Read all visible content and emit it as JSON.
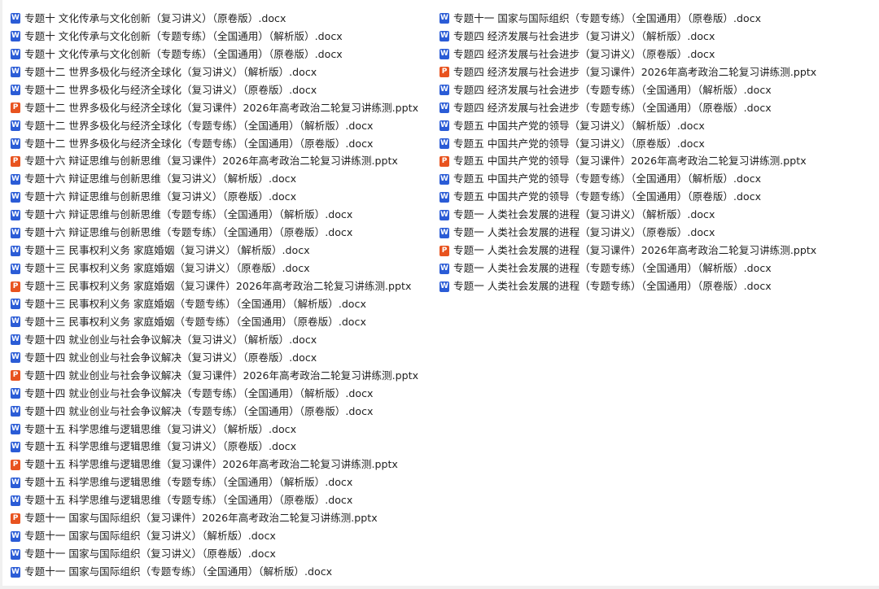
{
  "icons": {
    "docx": "word-doc-icon",
    "pptx": "powerpoint-icon",
    "docx_glyph": "W",
    "pptx_glyph": "P",
    "docx_color": "#2b5cd6",
    "pptx_color": "#e8531f"
  },
  "left_files": [
    {
      "type": "docx",
      "name": "专题十 文化传承与文化创新（复习讲义）（原卷版）.docx"
    },
    {
      "type": "docx",
      "name": "专题十 文化传承与文化创新（专题专练）（全国通用）（解析版）.docx"
    },
    {
      "type": "docx",
      "name": "专题十 文化传承与文化创新（专题专练）（全国通用）（原卷版）.docx"
    },
    {
      "type": "docx",
      "name": "专题十二 世界多极化与经济全球化（复习讲义）（解析版）.docx"
    },
    {
      "type": "docx",
      "name": "专题十二 世界多极化与经济全球化（复习讲义）（原卷版）.docx"
    },
    {
      "type": "pptx",
      "name": "专题十二 世界多极化与经济全球化（复习课件）2026年高考政治二轮复习讲练测.pptx"
    },
    {
      "type": "docx",
      "name": "专题十二 世界多极化与经济全球化（专题专练）（全国通用）（解析版）.docx"
    },
    {
      "type": "docx",
      "name": "专题十二 世界多极化与经济全球化（专题专练）（全国通用）（原卷版）.docx"
    },
    {
      "type": "pptx",
      "name": "专题十六 辩证思维与创新思维（复习课件）2026年高考政治二轮复习讲练测.pptx"
    },
    {
      "type": "docx",
      "name": "专题十六 辩证思维与创新思维（复习讲义）（解析版）.docx"
    },
    {
      "type": "docx",
      "name": "专题十六 辩证思维与创新思维（复习讲义）（原卷版）.docx"
    },
    {
      "type": "docx",
      "name": "专题十六 辩证思维与创新思维（专题专练）（全国通用）（解析版）.docx"
    },
    {
      "type": "docx",
      "name": "专题十六 辩证思维与创新思维（专题专练）（全国通用）（原卷版）.docx"
    },
    {
      "type": "docx",
      "name": "专题十三 民事权利义务 家庭婚姻（复习讲义）（解析版）.docx"
    },
    {
      "type": "docx",
      "name": "专题十三 民事权利义务 家庭婚姻（复习讲义）（原卷版）.docx"
    },
    {
      "type": "pptx",
      "name": "专题十三 民事权利义务 家庭婚姻（复习课件）2026年高考政治二轮复习讲练测.pptx"
    },
    {
      "type": "docx",
      "name": "专题十三 民事权利义务 家庭婚姻（专题专练）（全国通用）（解析版）.docx"
    },
    {
      "type": "docx",
      "name": "专题十三 民事权利义务 家庭婚姻（专题专练）（全国通用）（原卷版）.docx"
    },
    {
      "type": "docx",
      "name": "专题十四 就业创业与社会争议解决（复习讲义）（解析版）.docx"
    },
    {
      "type": "docx",
      "name": "专题十四 就业创业与社会争议解决（复习讲义）（原卷版）.docx"
    },
    {
      "type": "pptx",
      "name": "专题十四 就业创业与社会争议解决（复习课件）2026年高考政治二轮复习讲练测.pptx"
    },
    {
      "type": "docx",
      "name": "专题十四 就业创业与社会争议解决（专题专练）（全国通用）（解析版）.docx"
    },
    {
      "type": "docx",
      "name": "专题十四 就业创业与社会争议解决（专题专练）（全国通用）（原卷版）.docx"
    },
    {
      "type": "docx",
      "name": "专题十五 科学思维与逻辑思维（复习讲义）（解析版）.docx"
    },
    {
      "type": "docx",
      "name": "专题十五 科学思维与逻辑思维（复习讲义）（原卷版）.docx"
    },
    {
      "type": "pptx",
      "name": "专题十五 科学思维与逻辑思维（复习课件）2026年高考政治二轮复习讲练测.pptx"
    },
    {
      "type": "docx",
      "name": "专题十五 科学思维与逻辑思维（专题专练）（全国通用）（解析版）.docx"
    },
    {
      "type": "docx",
      "name": "专题十五 科学思维与逻辑思维（专题专练）（全国通用）（原卷版）.docx"
    },
    {
      "type": "pptx",
      "name": "专题十一 国家与国际组织（复习课件）2026年高考政治二轮复习讲练测.pptx"
    },
    {
      "type": "docx",
      "name": "专题十一 国家与国际组织（复习讲义）（解析版）.docx"
    },
    {
      "type": "docx",
      "name": "专题十一 国家与国际组织（复习讲义）（原卷版）.docx"
    },
    {
      "type": "docx",
      "name": "专题十一 国家与国际组织（专题专练）（全国通用）（解析版）.docx"
    }
  ],
  "right_files": [
    {
      "type": "docx",
      "name": "专题十一 国家与国际组织（专题专练）（全国通用）（原卷版）.docx"
    },
    {
      "type": "docx",
      "name": "专题四 经济发展与社会进步（复习讲义）（解析版）.docx"
    },
    {
      "type": "docx",
      "name": "专题四 经济发展与社会进步（复习讲义）（原卷版）.docx"
    },
    {
      "type": "pptx",
      "name": "专题四 经济发展与社会进步（复习课件）2026年高考政治二轮复习讲练测.pptx"
    },
    {
      "type": "docx",
      "name": "专题四 经济发展与社会进步（专题专练）（全国通用）（解析版）.docx"
    },
    {
      "type": "docx",
      "name": "专题四 经济发展与社会进步（专题专练）（全国通用）（原卷版）.docx"
    },
    {
      "type": "docx",
      "name": "专题五 中国共产党的领导（复习讲义）（解析版）.docx"
    },
    {
      "type": "docx",
      "name": "专题五 中国共产党的领导（复习讲义）（原卷版）.docx"
    },
    {
      "type": "pptx",
      "name": "专题五 中国共产党的领导（复习课件）2026年高考政治二轮复习讲练测.pptx"
    },
    {
      "type": "docx",
      "name": "专题五 中国共产党的领导（专题专练）（全国通用）（解析版）.docx"
    },
    {
      "type": "docx",
      "name": "专题五 中国共产党的领导（专题专练）（全国通用）（原卷版）.docx"
    },
    {
      "type": "docx",
      "name": "专题一 人类社会发展的进程（复习讲义）（解析版）.docx"
    },
    {
      "type": "docx",
      "name": "专题一 人类社会发展的进程（复习讲义）（原卷版）.docx"
    },
    {
      "type": "pptx",
      "name": "专题一 人类社会发展的进程（复习课件）2026年高考政治二轮复习讲练测.pptx"
    },
    {
      "type": "docx",
      "name": "专题一 人类社会发展的进程（专题专练）（全国通用）（解析版）.docx"
    },
    {
      "type": "docx",
      "name": "专题一 人类社会发展的进程（专题专练）（全国通用）（原卷版）.docx"
    }
  ]
}
